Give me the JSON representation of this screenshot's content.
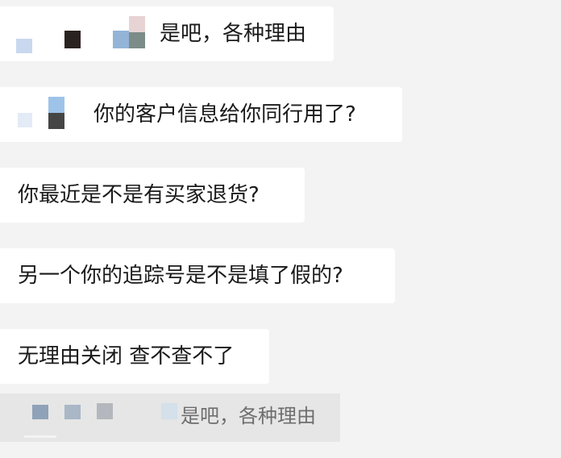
{
  "messages": [
    {
      "text": "是吧，各种理由",
      "has_masked_sender": true
    },
    {
      "text": "你的客户信息给你同行用了?",
      "has_masked_sender": true
    },
    {
      "text": "你最近是不是有买家退货?",
      "has_masked_sender": false
    },
    {
      "text": "另一个你的追踪号是不是填了假的?",
      "has_masked_sender": false
    },
    {
      "text": "无理由关闭 查不查不了",
      "has_masked_sender": false
    }
  ],
  "quoted_reply": {
    "text": "是吧，各种理由",
    "has_masked_sender": true
  },
  "colors": {
    "background": "#f3f3f3",
    "bubble": "#ffffff",
    "text": "#1a1a1a",
    "quoted_background": "#e6e6e6",
    "quoted_text": "#6e6e6e"
  }
}
